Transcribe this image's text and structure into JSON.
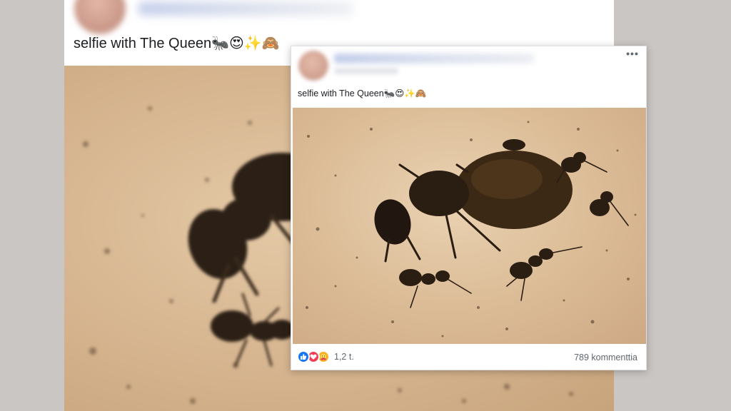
{
  "post": {
    "caption": "selfie with The Queen",
    "caption_emojis": "🐜😍✨🙈",
    "more_menu_label": "•••",
    "reaction_count": "1,2 t.",
    "comment_count": "789 kommenttia",
    "reaction_icons": [
      "like-icon",
      "love-icon",
      "care-icon"
    ]
  },
  "colors": {
    "like": "#1877f2",
    "love": "#f33e58",
    "care": "#f7b125",
    "text_primary": "#1c1e21",
    "text_secondary": "#606770"
  }
}
